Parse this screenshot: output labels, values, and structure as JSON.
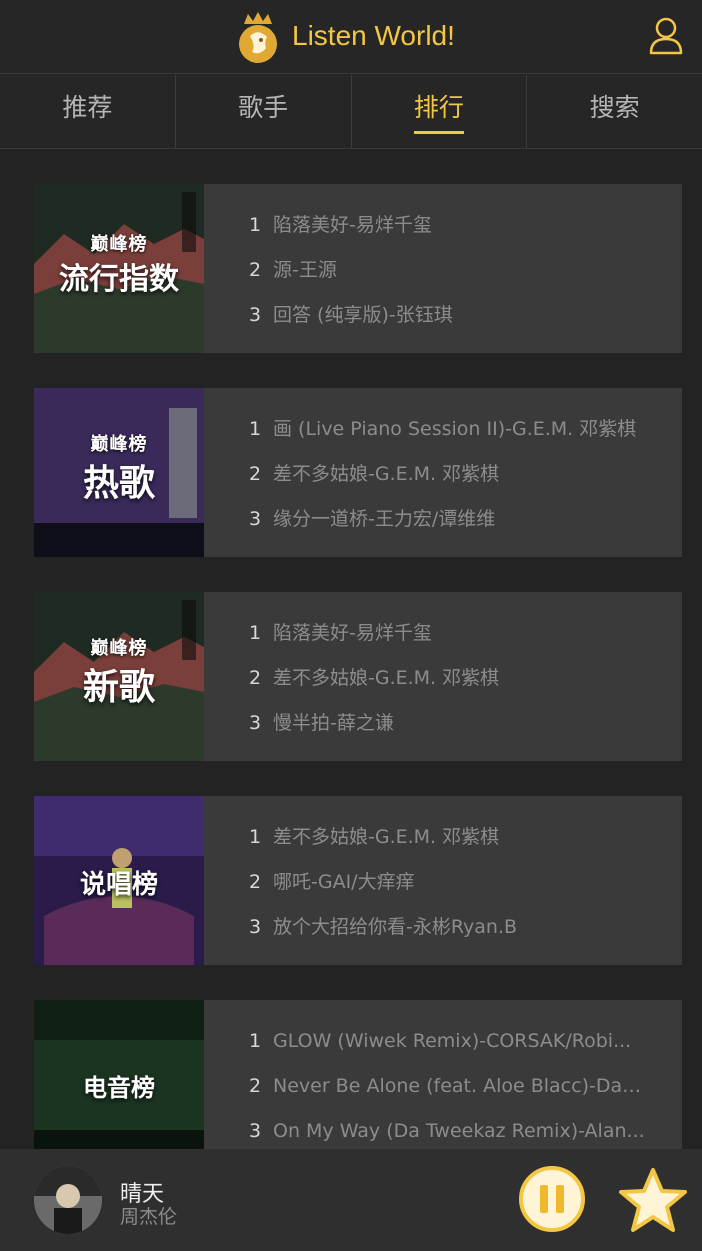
{
  "header": {
    "title": "Listen World!",
    "logo_icon": "crown-lion-logo",
    "user_icon": "user-icon"
  },
  "tabs": [
    {
      "label": "推荐",
      "active": false
    },
    {
      "label": "歌手",
      "active": false
    },
    {
      "label": "排行",
      "active": true
    },
    {
      "label": "搜索",
      "active": false
    }
  ],
  "charts": [
    {
      "cover_label": "流行指数",
      "cover_badge": "巅峰榜",
      "songs": [
        {
          "rank": "1",
          "title": "陷落美好-易烊千玺"
        },
        {
          "rank": "2",
          "title": "源-王源"
        },
        {
          "rank": "3",
          "title": "回答 (纯享版)-张钰琪"
        }
      ]
    },
    {
      "cover_label": "热歌",
      "cover_badge": "巅峰榜",
      "songs": [
        {
          "rank": "1",
          "title": "画 (Live Piano Session II)-G.E.M. 邓紫棋"
        },
        {
          "rank": "2",
          "title": "差不多姑娘-G.E.M. 邓紫棋"
        },
        {
          "rank": "3",
          "title": "缘分一道桥-王力宏/谭维维"
        }
      ]
    },
    {
      "cover_label": "新歌",
      "cover_badge": "巅峰榜",
      "songs": [
        {
          "rank": "1",
          "title": "陷落美好-易烊千玺"
        },
        {
          "rank": "2",
          "title": "差不多姑娘-G.E.M. 邓紫棋"
        },
        {
          "rank": "3",
          "title": "慢半拍-薛之谦"
        }
      ]
    },
    {
      "cover_label": "说唱榜",
      "cover_badge": "",
      "songs": [
        {
          "rank": "1",
          "title": "差不多姑娘-G.E.M. 邓紫棋"
        },
        {
          "rank": "2",
          "title": "哪吒-GAI/大痒痒"
        },
        {
          "rank": "3",
          "title": "放个大招给你看-永彬Ryan.B"
        }
      ]
    },
    {
      "cover_label": "电音榜",
      "cover_badge": "",
      "songs": [
        {
          "rank": "1",
          "title": "GLOW (Wiwek Remix)-CORSAK/Robi..."
        },
        {
          "rank": "2",
          "title": "Never Be Alone (feat. Aloe Blacc)-Davi..."
        },
        {
          "rank": "3",
          "title": "On My Way (Da Tweekaz Remix)-Alan..."
        }
      ]
    }
  ],
  "player": {
    "song_title": "晴天",
    "artist": "周杰伦",
    "pause_icon": "pause-icon",
    "favorite_icon": "star-icon",
    "accent_color": "#f3c744"
  }
}
